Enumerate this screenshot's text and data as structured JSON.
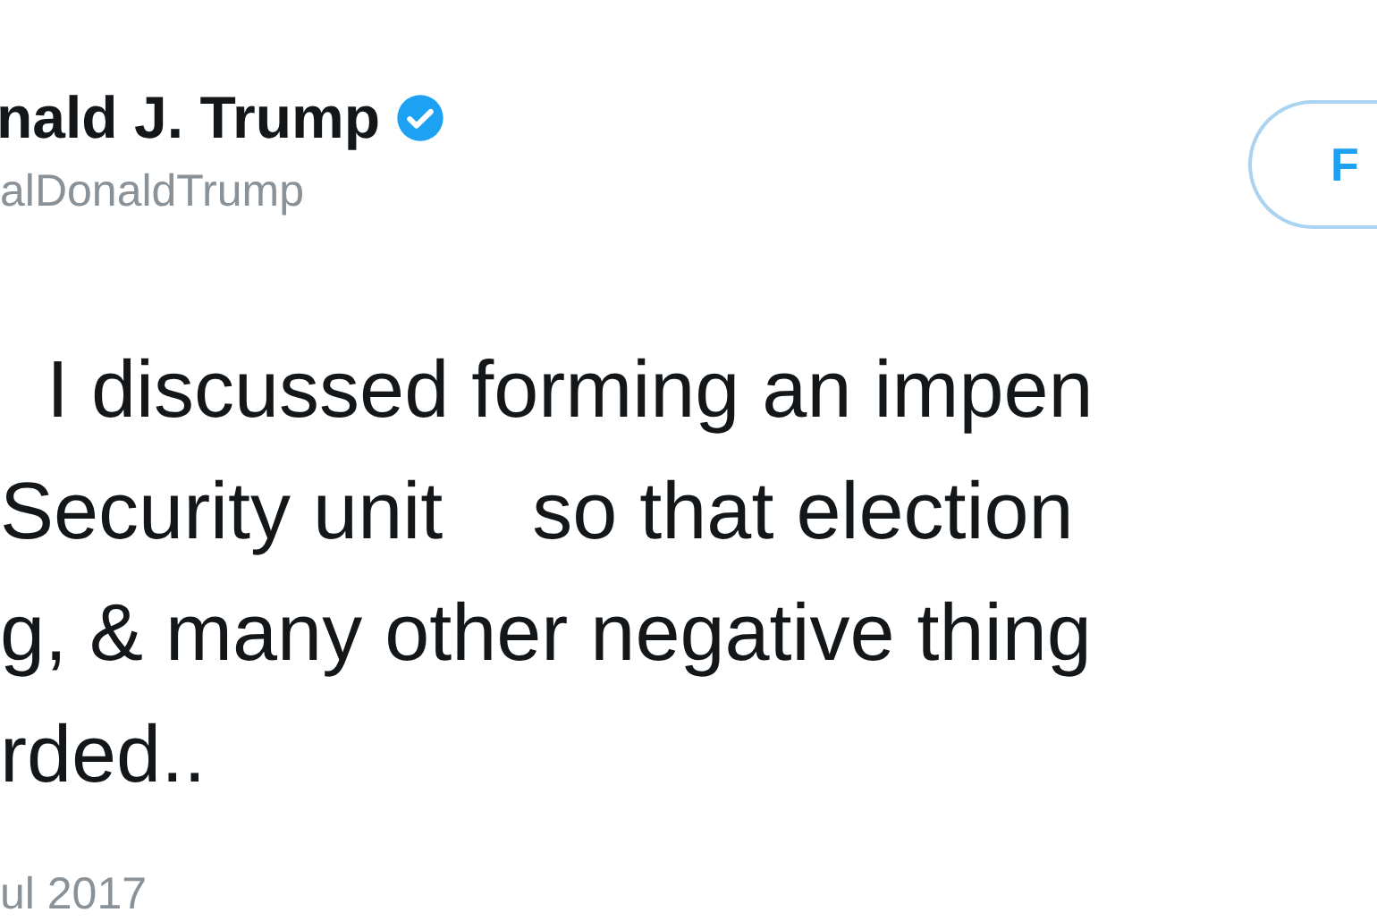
{
  "author": {
    "name": "nald J. Trump",
    "verified": true,
    "handle": "alDonaldTrump"
  },
  "follow_button": {
    "label": "F"
  },
  "tweet": {
    "lines": [
      "I discussed forming an impen",
      "Security unit    so that election",
      "g, & many other negative thing",
      "rded.."
    ],
    "date": "ul 2017"
  }
}
